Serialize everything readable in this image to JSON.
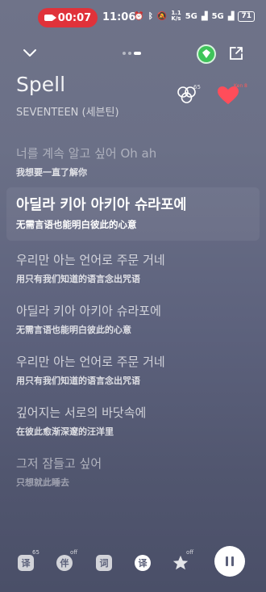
{
  "status_bar": {
    "recording_time": "00:07",
    "clock": "11:06",
    "net_speed_top": "1.1",
    "net_speed_bottom": "K/s",
    "network_1": "5G",
    "network_2": "5G",
    "battery": "71"
  },
  "song": {
    "title": "Spell",
    "artist": "SEVENTEEN (세븐틴)",
    "comment_count": "65",
    "like_count": "Ken 8"
  },
  "lyrics": [
    {
      "ko": "너를 계속 알고 싶어 Oh ah",
      "zh": "我想要一直了解你"
    },
    {
      "ko": "아딜라 키아 아키아 슈라포에",
      "zh": "无需言语也能明白彼此的心意"
    },
    {
      "ko": "우리만 아는 언어로 주문 거네",
      "zh": "用只有我们知道的语言念出咒语"
    },
    {
      "ko": "아딜라 키아 아키아 슈라포에",
      "zh": "无需言语也能明白彼此的心意"
    },
    {
      "ko": "우리만 아는 언어로 주문 거네",
      "zh": "用只有我们知道的语言念出咒语"
    },
    {
      "ko": "깊어지는 서로의 바닷속에",
      "zh": "在彼此愈渐深邃的汪洋里"
    },
    {
      "ko": "그저 잠들고 싶어",
      "zh": "只想就此睡去"
    }
  ],
  "bottom_bar": {
    "translate_label": "译",
    "translate_count": "65",
    "voice_label": "伴",
    "voice_badge": "off",
    "lyrics_label": "词",
    "translate2_label": "译",
    "effect_badge": "off"
  },
  "colors": {
    "record": "#e0323a",
    "vip": "#3fc45a",
    "like": "#ff4d5a"
  }
}
